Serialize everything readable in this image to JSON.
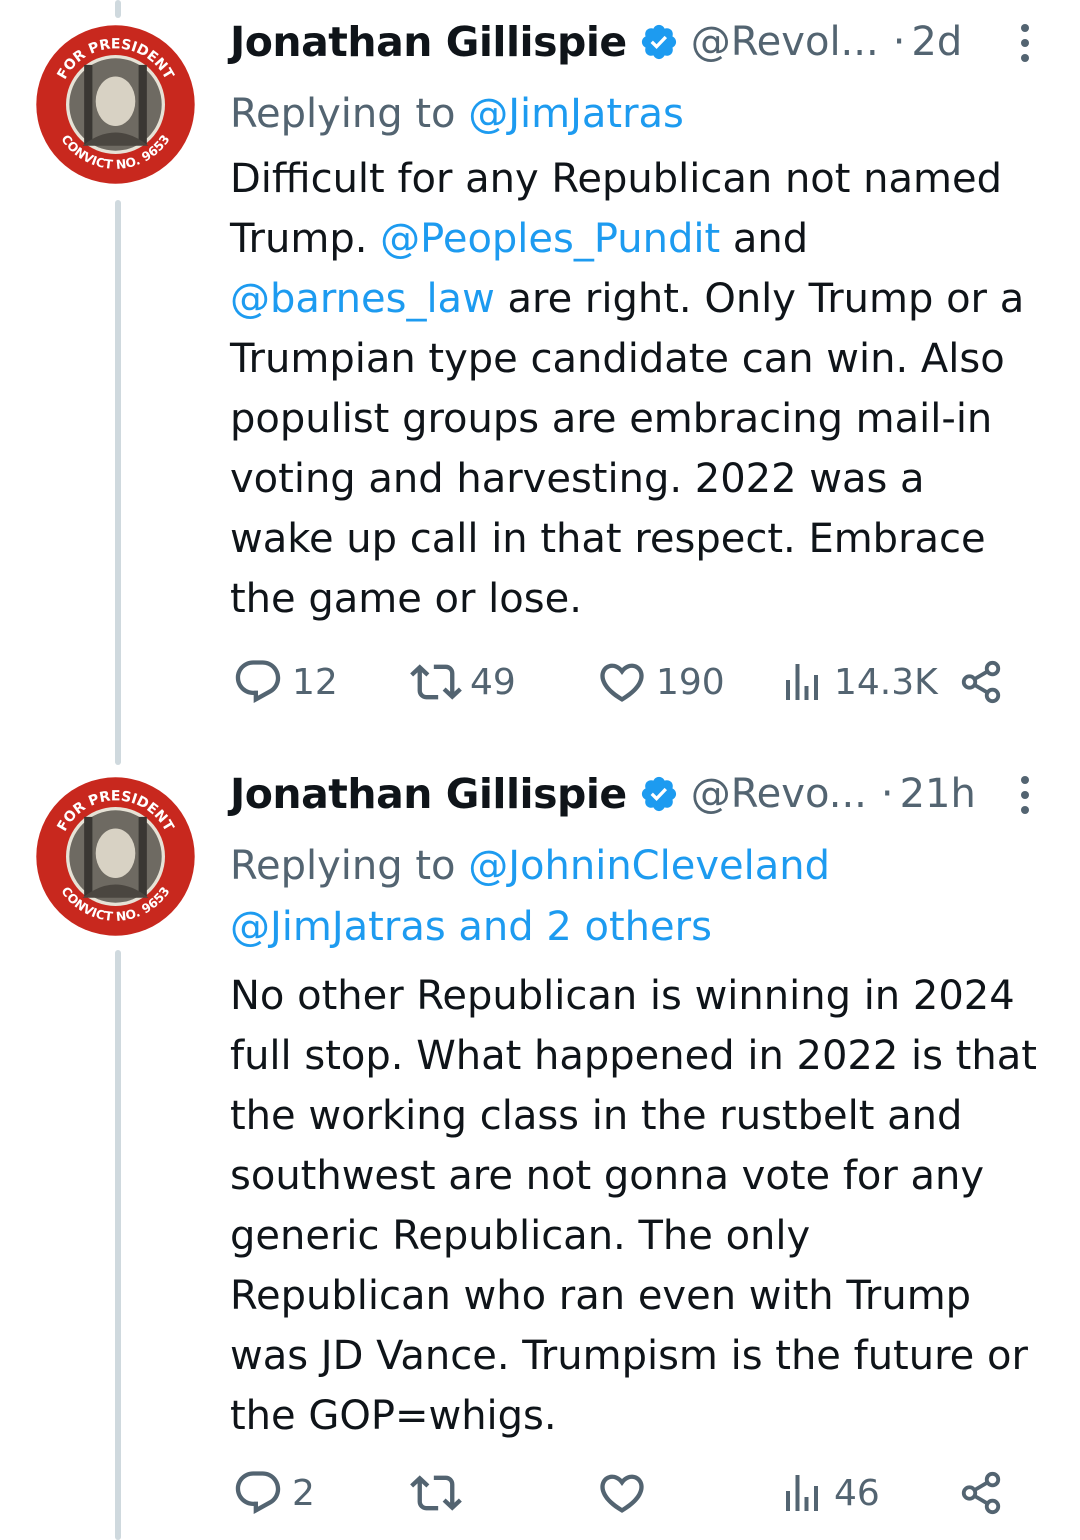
{
  "tweets": [
    {
      "name": "Jonathan Gillispie",
      "handle": "@Revol...",
      "time": "2d",
      "reply_prefix": "Replying to ",
      "reply_to": "@JimJatras",
      "reply_to_line2": "",
      "body_parts": [
        {
          "t": "Difficult for any Republican not named Trump. ",
          "link": false
        },
        {
          "t": "@Peoples_Pundit",
          "link": true
        },
        {
          "t": " and ",
          "link": false
        },
        {
          "t": "@barnes_law",
          "link": true
        },
        {
          "t": " are right. Only Trump or a Trumpian type candidate can win. Also populist groups are embracing mail-in voting and harvesting. 2022 was a wake up call in that respect. Embrace the game or lose.",
          "link": false
        }
      ],
      "stats": {
        "replies": "12",
        "retweets": "49",
        "likes": "190",
        "views": "14.3K"
      }
    },
    {
      "name": "Jonathan Gillispie",
      "handle": "@Revo...",
      "time": "21h",
      "reply_prefix": "Replying to ",
      "reply_to": "@JohninCleveland",
      "reply_to_line2": "@JimJatras and 2 others",
      "body_parts": [
        {
          "t": "No other Republican is winning in 2024 full stop. What happened in 2022 is that the working class in the rustbelt and southwest are not gonna vote for any generic Republican. The only Republican who ran even with Trump was JD Vance. Trumpism is the future or the GOP=whigs.",
          "link": false
        }
      ],
      "stats": {
        "replies": "2",
        "retweets": "",
        "likes": "",
        "views": "46"
      }
    }
  ],
  "avatar": {
    "top_text": "FOR PRESIDENT",
    "bottom_text": "CONVICT NO. 9653"
  },
  "colors": {
    "link": "#1d9bf0",
    "secondary": "#536471",
    "verified": "#1d9bf0",
    "thread": "#cfd9de",
    "badge_red": "#c8281e"
  }
}
